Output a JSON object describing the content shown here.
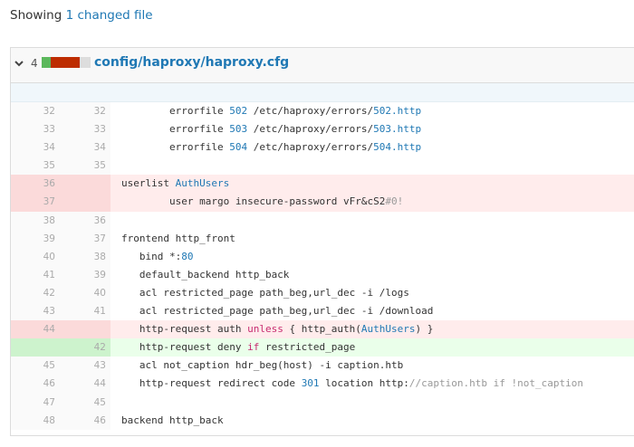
{
  "summary": {
    "prefix": "Showing ",
    "link": "1 changed file"
  },
  "file": {
    "change_count": "4",
    "path": "config/haproxy/haproxy.cfg",
    "colors": {
      "added": "#5cb85c",
      "removed": "#bd2c00",
      "neutral": "#dddddd"
    }
  },
  "lines": [
    {
      "old": "32",
      "new": "32",
      "type": "ctx",
      "segs": [
        {
          "t": "        errorfile "
        },
        {
          "t": "502",
          "c": "num"
        },
        {
          "t": " /etc/haproxy/errors/"
        },
        {
          "t": "502.http",
          "c": "id"
        }
      ]
    },
    {
      "old": "33",
      "new": "33",
      "type": "ctx",
      "segs": [
        {
          "t": "        errorfile "
        },
        {
          "t": "503",
          "c": "num"
        },
        {
          "t": " /etc/haproxy/errors/"
        },
        {
          "t": "503.http",
          "c": "id"
        }
      ]
    },
    {
      "old": "34",
      "new": "34",
      "type": "ctx",
      "segs": [
        {
          "t": "        errorfile "
        },
        {
          "t": "504",
          "c": "num"
        },
        {
          "t": " /etc/haproxy/errors/"
        },
        {
          "t": "504.http",
          "c": "id"
        }
      ]
    },
    {
      "old": "35",
      "new": "35",
      "type": "ctx",
      "segs": [
        {
          "t": ""
        }
      ]
    },
    {
      "old": "36",
      "new": "",
      "type": "del",
      "segs": [
        {
          "t": "userlist "
        },
        {
          "t": "AuthUsers",
          "c": "id"
        }
      ]
    },
    {
      "old": "37",
      "new": "",
      "type": "del",
      "segs": [
        {
          "t": "        user margo insecure-password vFr&cS2"
        },
        {
          "t": "#0!",
          "c": "cmt"
        }
      ]
    },
    {
      "old": "38",
      "new": "36",
      "type": "ctx",
      "segs": [
        {
          "t": ""
        }
      ]
    },
    {
      "old": "39",
      "new": "37",
      "type": "ctx",
      "segs": [
        {
          "t": "frontend http_front"
        }
      ]
    },
    {
      "old": "40",
      "new": "38",
      "type": "ctx",
      "segs": [
        {
          "t": "   bind *:"
        },
        {
          "t": "80",
          "c": "num"
        }
      ]
    },
    {
      "old": "41",
      "new": "39",
      "type": "ctx",
      "segs": [
        {
          "t": "   default_backend http_back"
        }
      ]
    },
    {
      "old": "42",
      "new": "40",
      "type": "ctx",
      "segs": [
        {
          "t": "   acl restricted_page path_beg,url_dec -i /logs"
        }
      ]
    },
    {
      "old": "43",
      "new": "41",
      "type": "ctx",
      "segs": [
        {
          "t": "   acl restricted_page path_beg,url_dec -i /download"
        }
      ]
    },
    {
      "old": "44",
      "new": "",
      "type": "del",
      "segs": [
        {
          "t": "   http-request auth "
        },
        {
          "t": "unless",
          "c": "kw"
        },
        {
          "t": " { http_auth("
        },
        {
          "t": "AuthUsers",
          "c": "id"
        },
        {
          "t": ") }"
        }
      ]
    },
    {
      "old": "",
      "new": "42",
      "type": "add",
      "segs": [
        {
          "t": "   http-request deny "
        },
        {
          "t": "if",
          "c": "kw"
        },
        {
          "t": " restricted_page"
        }
      ]
    },
    {
      "old": "45",
      "new": "43",
      "type": "ctx",
      "segs": [
        {
          "t": "   acl not_caption hdr_beg(host) -i caption.htb"
        }
      ]
    },
    {
      "old": "46",
      "new": "44",
      "type": "ctx",
      "segs": [
        {
          "t": "   http-request redirect code "
        },
        {
          "t": "301",
          "c": "num"
        },
        {
          "t": " location http:"
        },
        {
          "t": "//caption.htb if !not_caption",
          "c": "cmt"
        }
      ]
    },
    {
      "old": "47",
      "new": "45",
      "type": "ctx",
      "segs": [
        {
          "t": ""
        }
      ]
    },
    {
      "old": "48",
      "new": "46",
      "type": "ctx",
      "segs": [
        {
          "t": "backend http_back"
        }
      ]
    }
  ]
}
